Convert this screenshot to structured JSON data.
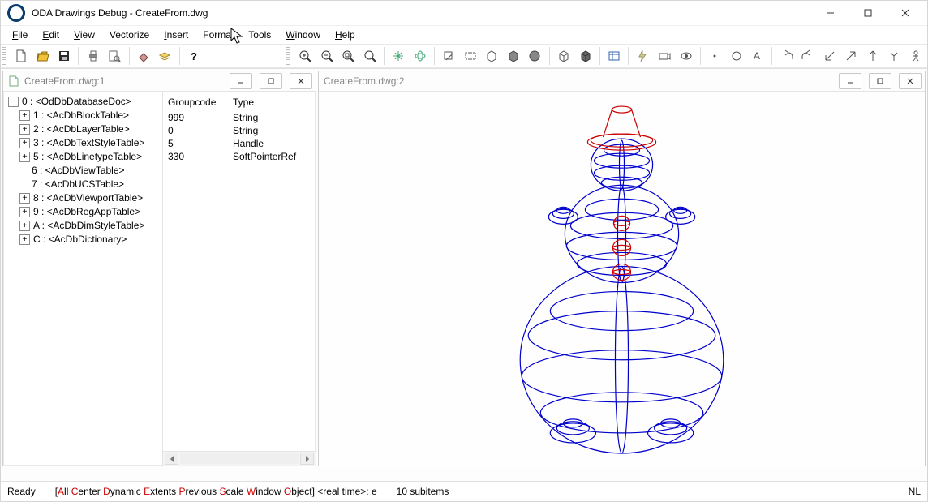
{
  "title": "ODA Drawings Debug - CreateFrom.dwg",
  "menus": {
    "file": {
      "accel": "F",
      "rest": "ile"
    },
    "edit": {
      "accel": "E",
      "rest": "dit"
    },
    "view": {
      "accel": "V",
      "rest": "iew"
    },
    "vectorize": {
      "label": "Vectorize"
    },
    "insert": {
      "accel": "I",
      "rest": "nsert"
    },
    "format": {
      "label": "Format"
    },
    "tools": {
      "label": "Tools"
    },
    "window": {
      "accel": "W",
      "rest": "indow"
    },
    "help": {
      "accel": "H",
      "rest": "elp"
    }
  },
  "mdi": {
    "left_title": "CreateFrom.dwg:1",
    "right_title": "CreateFrom.dwg:2"
  },
  "tree": {
    "root": {
      "id": "0",
      "label": "<OdDbDatabaseDoc>"
    },
    "children": [
      {
        "id": "1",
        "label": "<AcDbBlockTable>",
        "expand": "plus"
      },
      {
        "id": "2",
        "label": "<AcDbLayerTable>",
        "expand": "plus"
      },
      {
        "id": "3",
        "label": "<AcDbTextStyleTable>",
        "expand": "plus"
      },
      {
        "id": "5",
        "label": "<AcDbLinetypeTable>",
        "expand": "plus"
      },
      {
        "id": "6",
        "label": "<AcDbViewTable>",
        "expand": "none"
      },
      {
        "id": "7",
        "label": "<AcDbUCSTable>",
        "expand": "none"
      },
      {
        "id": "8",
        "label": "<AcDbViewportTable>",
        "expand": "plus"
      },
      {
        "id": "9",
        "label": "<AcDbRegAppTable>",
        "expand": "plus"
      },
      {
        "id": "A",
        "label": "<AcDbDimStyleTable>",
        "expand": "plus"
      },
      {
        "id": "C",
        "label": "<AcDbDictionary>",
        "expand": "plus"
      }
    ]
  },
  "props": {
    "header_a": "Groupcode",
    "header_b": "Type",
    "rows": [
      {
        "a": "999",
        "b": "String"
      },
      {
        "a": "0",
        "b": "String"
      },
      {
        "a": "5",
        "b": "Handle"
      },
      {
        "a": "330",
        "b": "SoftPointerRef"
      }
    ]
  },
  "status": {
    "ready": "Ready",
    "cmds": [
      {
        "r": "A",
        "t": "ll "
      },
      {
        "r": "C",
        "t": "enter "
      },
      {
        "r": "D",
        "t": "ynamic "
      },
      {
        "r": "E",
        "t": "xtents "
      },
      {
        "r": "P",
        "t": "revious "
      },
      {
        "r": "S",
        "t": "cale "
      },
      {
        "r": "W",
        "t": "indow "
      },
      {
        "r": "O",
        "t": "bject"
      }
    ],
    "tail": "] <real time>: e",
    "subitems": "10 subitems",
    "nl": "NL"
  }
}
